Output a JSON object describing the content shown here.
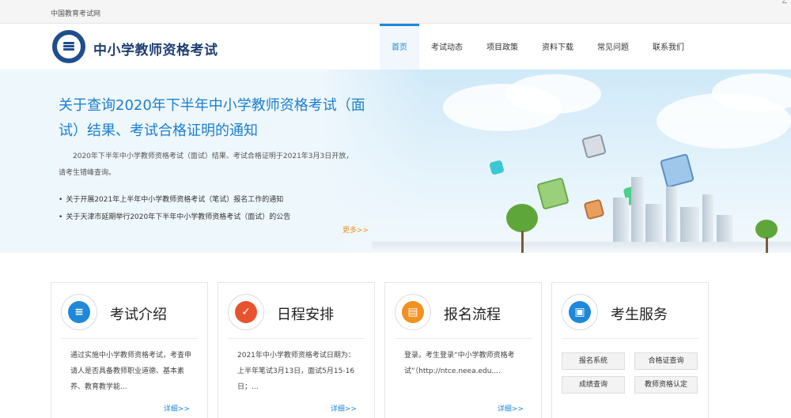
{
  "topbar": {
    "site_name": "中国教育考试网"
  },
  "header": {
    "brand": "中小学教师资格考试",
    "nav": [
      {
        "label": "首页",
        "active": true
      },
      {
        "label": "考试动态",
        "active": false
      },
      {
        "label": "项目政策",
        "active": false
      },
      {
        "label": "资料下载",
        "active": false
      },
      {
        "label": "常见问题",
        "active": false
      },
      {
        "label": "联系我们",
        "active": false
      }
    ]
  },
  "hero": {
    "headline": "关于查询2020年下半年中小学教师资格考试（面试）结果、考试合格证明的通知",
    "description": "2020年下半年中小学教师资格考试（面试）结果、考试合格证明于2021年3月3日开放，请考生错峰查询。",
    "news": [
      "关于开展2021年上半年中小学教师资格考试（笔试）报名工作的通知",
      "关于天津市延期举行2020年下半年中小学教师资格考试（面试）的公告"
    ],
    "more_link": "更多>>"
  },
  "cards": [
    {
      "title": "考试介绍",
      "icon": "document-icon",
      "color": "#1e88d9",
      "text": "通过实施中小学教师资格考试，考查申请人是否具备教师职业道德、基本素养、教育教学能...",
      "detail": "详细>>"
    },
    {
      "title": "日程安排",
      "icon": "checkmark-icon",
      "color": "#e8532f",
      "text": "2021年中小学教师资格考试日期为：上半年笔试3月13日，面试5月15-16日；...",
      "detail": "详细>>"
    },
    {
      "title": "报名流程",
      "icon": "form-icon",
      "color": "#f29020",
      "text": "登录。考生登录“中小学教师资格考试”（http://ntce.neea.edu....",
      "detail": "详细>>"
    },
    {
      "title": "考生服务",
      "icon": "contact-book-icon",
      "color": "#1e88d9",
      "services": [
        "报名系统",
        "合格证查询",
        "成绩查询",
        "教师资格认定"
      ]
    }
  ]
}
